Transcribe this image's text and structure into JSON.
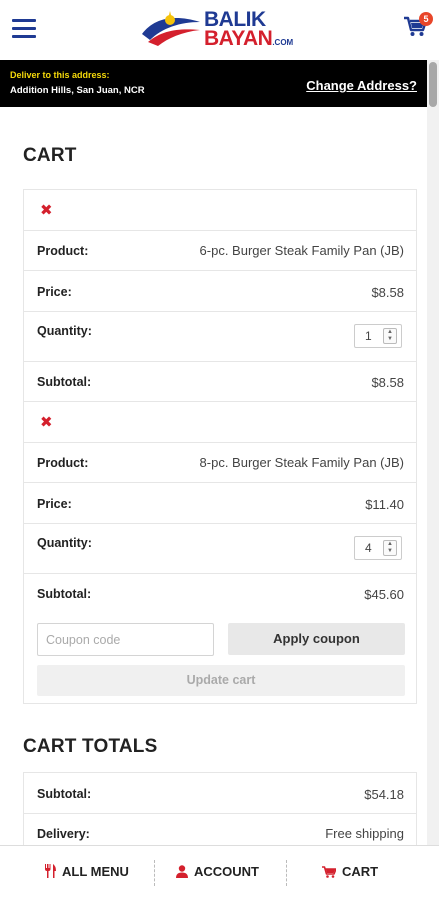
{
  "header": {
    "logo": {
      "line1": "BALIK",
      "line2": "BAYAN",
      "suffix": ".COM"
    },
    "cart_count": "5"
  },
  "address": {
    "label": "Deliver to this address:",
    "value": "Addition Hills, San Juan, NCR",
    "change_label": "Change Address?"
  },
  "cart": {
    "title": "CART",
    "items": [
      {
        "remove_icon": "✖",
        "product_label": "Product:",
        "product": "6-pc. Burger Steak Family Pan (JB)",
        "price_label": "Price:",
        "price": "$8.58",
        "quantity_label": "Quantity:",
        "quantity": "1",
        "subtotal_label": "Subtotal:",
        "subtotal": "$8.58"
      },
      {
        "remove_icon": "✖",
        "product_label": "Product:",
        "product": "8-pc. Burger Steak Family Pan (JB)",
        "price_label": "Price:",
        "price": "$11.40",
        "quantity_label": "Quantity:",
        "quantity": "4",
        "subtotal_label": "Subtotal:",
        "subtotal": "$45.60"
      }
    ],
    "coupon_placeholder": "Coupon code",
    "apply_label": "Apply coupon",
    "update_label": "Update cart"
  },
  "totals": {
    "title": "CART TOTALS",
    "subtotal_label": "Subtotal:",
    "subtotal": "$54.18",
    "delivery_label": "Delivery:",
    "delivery": "Free shipping"
  },
  "nav": {
    "menu_label": "ALL MENU",
    "account_label": "ACCOUNT",
    "cart_label": "CART"
  },
  "colors": {
    "brand_blue": "#1f3a93",
    "brand_red": "#d4202d",
    "address_yellow": "#f5d90a"
  }
}
